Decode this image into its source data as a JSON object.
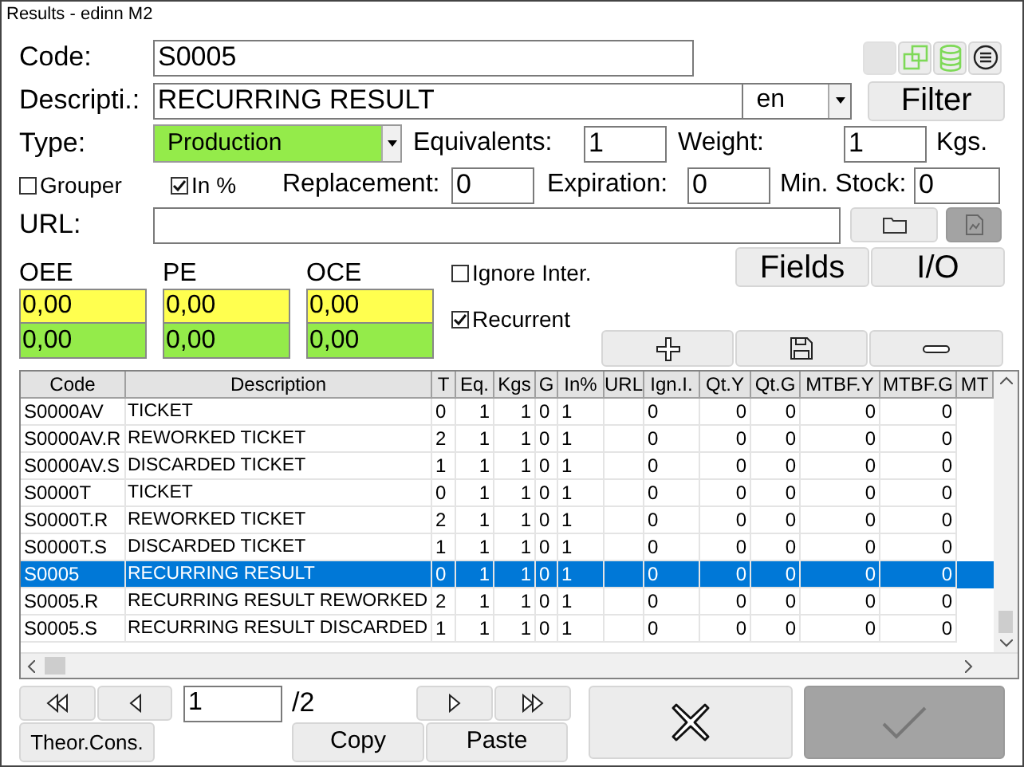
{
  "window": {
    "title": "Results - edinn M2"
  },
  "form": {
    "code_label": "Code:",
    "code": "S0005",
    "description_label": "Descripti.:",
    "description": "RECURRING RESULT",
    "language": "en",
    "filter_button": "Filter",
    "type_label": "Type:",
    "type": "Production",
    "equivalents_label": "Equivalents:",
    "equivalents": "1",
    "weight_label": "Weight:",
    "weight": "1",
    "weight_unit": "Kgs.",
    "grouper": {
      "label": "Grouper",
      "checked": false
    },
    "in_percent": {
      "label": "In %",
      "checked": true
    },
    "replacement_label": "Replacement:",
    "replacement": "0",
    "expiration_label": "Expiration:",
    "expiration": "0",
    "min_stock_label": "Min. Stock:",
    "min_stock": "0",
    "url_label": "URL:",
    "url_open_disabled": true
  },
  "toolbar": [
    {
      "kind": "blank"
    },
    {
      "kind": "copy"
    },
    {
      "kind": "database"
    },
    {
      "kind": "menu"
    }
  ],
  "indicators": [
    {
      "label": "OEE",
      "target": "0,00",
      "actual": "0,00"
    },
    {
      "label": "PE",
      "target": "0,00",
      "actual": "0,00"
    },
    {
      "label": "OCE",
      "target": "0,00",
      "actual": "0,00"
    }
  ],
  "options": [
    {
      "label": "Ignore Inter.",
      "checked": false
    },
    {
      "label": "Recurrent",
      "checked": true
    }
  ],
  "tabs_buttons": [
    "Fields",
    "I/O"
  ],
  "table": {
    "columns": [
      "Code",
      "Description",
      "T",
      "Eq.",
      "Kgs",
      "G",
      "In%",
      "URL",
      "Ign.I.",
      "Qt.Y",
      "Qt.G",
      "MTBF.Y",
      "MTBF.G",
      "MT"
    ],
    "rows": [
      {
        "selected": false,
        "cells": [
          "S0000AV",
          "TICKET",
          "0",
          "1",
          "1",
          "0",
          "1",
          "",
          "0",
          "0",
          "0",
          "0",
          "0"
        ]
      },
      {
        "selected": false,
        "cells": [
          "S0000AV.R",
          "REWORKED TICKET",
          "2",
          "1",
          "1",
          "0",
          "1",
          "",
          "0",
          "0",
          "0",
          "0",
          "0"
        ]
      },
      {
        "selected": false,
        "cells": [
          "S0000AV.S",
          "DISCARDED TICKET",
          "1",
          "1",
          "1",
          "0",
          "1",
          "",
          "0",
          "0",
          "0",
          "0",
          "0"
        ]
      },
      {
        "selected": false,
        "cells": [
          "S0000T",
          "TICKET",
          "0",
          "1",
          "1",
          "0",
          "1",
          "",
          "0",
          "0",
          "0",
          "0",
          "0"
        ]
      },
      {
        "selected": false,
        "cells": [
          "S0000T.R",
          "REWORKED TICKET",
          "2",
          "1",
          "1",
          "0",
          "1",
          "",
          "0",
          "0",
          "0",
          "0",
          "0"
        ]
      },
      {
        "selected": false,
        "cells": [
          "S0000T.S",
          "DISCARDED TICKET",
          "1",
          "1",
          "1",
          "0",
          "1",
          "",
          "0",
          "0",
          "0",
          "0",
          "0"
        ]
      },
      {
        "selected": true,
        "cells": [
          "S0005",
          "RECURRING RESULT",
          "0",
          "1",
          "1",
          "0",
          "1",
          "",
          "0",
          "0",
          "0",
          "0",
          "0"
        ]
      },
      {
        "selected": false,
        "cells": [
          "S0005.R",
          "RECURRING RESULT REWORKED",
          "2",
          "1",
          "1",
          "0",
          "1",
          "",
          "0",
          "0",
          "0",
          "0",
          "0"
        ]
      },
      {
        "selected": false,
        "cells": [
          "S0005.S",
          "RECURRING RESULT DISCARDED",
          "1",
          "1",
          "1",
          "0",
          "1",
          "",
          "0",
          "0",
          "0",
          "0",
          "0"
        ]
      }
    ]
  },
  "pager": {
    "page": "1",
    "total": "/2"
  },
  "buttons": {
    "theor_cons": "Theor.Cons.",
    "copy": "Copy",
    "paste": "Paste",
    "accept_disabled": true
  }
}
